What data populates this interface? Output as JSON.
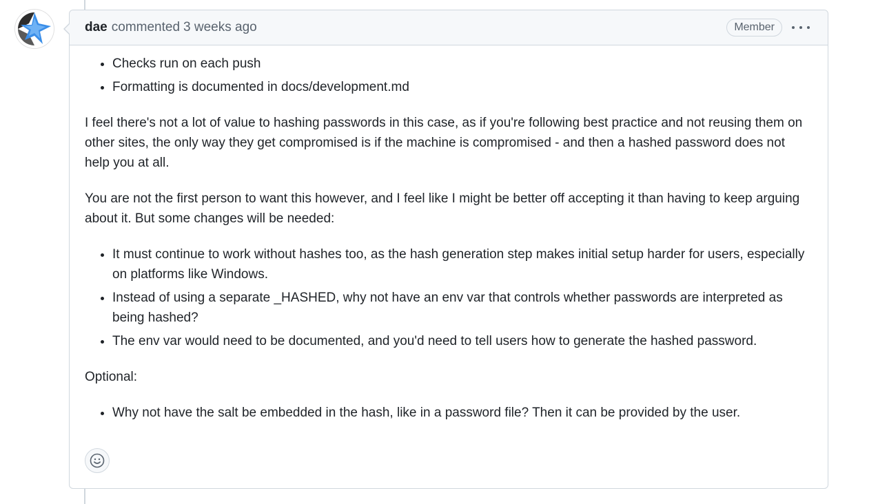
{
  "comment": {
    "author": "dae",
    "action": "commented",
    "time": "3 weeks ago",
    "badge": "Member",
    "list1": [
      "Checks run on each push",
      "Formatting is documented in docs/development.md"
    ],
    "para1": "I feel there's not a lot of value to hashing passwords in this case, as if you're following best practice and not reusing them on other sites, the only way they get compromised is if the machine is compromised - and then a hashed password does not help you at all.",
    "para2": "You are not the first person to want this however, and I feel like I might be better off accepting it than having to keep arguing about it. But some changes will be needed:",
    "list2": [
      "It must continue to work without hashes too, as the hash generation step makes initial setup harder for users, especially on platforms like Windows.",
      "Instead of using a separate _HASHED, why not have an env var that controls whether passwords are interpreted as being hashed?",
      "The env var would need to be documented, and you'd need to tell users how to generate the hashed password."
    ],
    "optional_label": "Optional:",
    "list3": [
      "Why not have the salt be embedded in the hash, like in a password file? Then it can be provided by the user."
    ]
  },
  "icons": {
    "menu": "kebab-horizontal-icon",
    "reaction": "smiley-icon",
    "avatar": "avatar-logo"
  },
  "colors": {
    "border": "#d0d7de",
    "header_bg": "#f6f8fa",
    "muted_text": "#59636e",
    "text": "#1f2328",
    "avatar_blue": "#3b8ee8"
  }
}
